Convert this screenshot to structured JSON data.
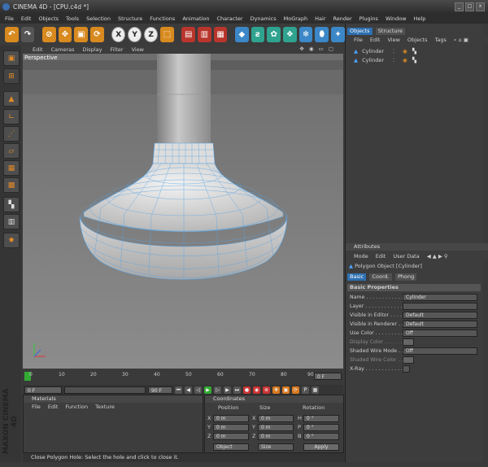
{
  "window": {
    "app": "CINEMA 4D",
    "file": "[CPU.c4d *]",
    "min": "_",
    "max": "□",
    "close": "x"
  },
  "menu": [
    "File",
    "Edit",
    "Objects",
    "Tools",
    "Selection",
    "Structure",
    "Functions",
    "Animation",
    "Character",
    "Dynamics",
    "MoGraph",
    "Hair",
    "Render",
    "Plugins",
    "Window",
    "Help"
  ],
  "toolbar": {
    "x": "X",
    "y": "Y",
    "z": "Z"
  },
  "viewport": {
    "menu": [
      "Edit",
      "Cameras",
      "Display",
      "Filter",
      "View"
    ],
    "label": "Perspective",
    "nav_icons": "✥ ◉ ▭ ▢"
  },
  "timeline": {
    "ticks": [
      "0",
      "10",
      "20",
      "30",
      "40",
      "50",
      "60",
      "70",
      "80",
      "90"
    ],
    "frame_end_label": "0 F"
  },
  "playback": {
    "start": "0 F",
    "end": "90 F"
  },
  "materials": {
    "title": "Materials",
    "menu": [
      "File",
      "Edit",
      "Function",
      "Texture"
    ]
  },
  "coordinates": {
    "title": "Coordinates",
    "cols": [
      "Position",
      "Size",
      "Rotation"
    ],
    "rows": [
      {
        "a": "X",
        "av": "0 m",
        "b": "X",
        "bv": "0 m",
        "c": "H",
        "cv": "0 °"
      },
      {
        "a": "Y",
        "av": "0 m",
        "b": "Y",
        "bv": "0 m",
        "c": "P",
        "cv": "0 °"
      },
      {
        "a": "Z",
        "av": "0 m",
        "b": "Z",
        "bv": "0 m",
        "c": "B",
        "cv": "0 °"
      }
    ],
    "mode": "Object",
    "size_mode": "Size",
    "apply": "Apply"
  },
  "status": "Close Polygon Hole: Select the hole and click to close it.",
  "maxon": "MAXON CINEMA 4D",
  "objects": {
    "tabs": [
      "Objects",
      "Structure"
    ],
    "menu": [
      "File",
      "Edit",
      "View",
      "Objects",
      "Tags"
    ],
    "items": [
      "Cylinder",
      "Cylinder"
    ]
  },
  "attributes": {
    "title": "Attributes",
    "menu": [
      "Mode",
      "Edit",
      "User Data"
    ],
    "object": "Polygon Object [Cylinder]",
    "tabs": [
      "Basic",
      "Coord.",
      "Phong"
    ],
    "section": "Basic Properties",
    "rows": [
      {
        "label": "Name . . . . . . . . . . . .",
        "value": "Cylinder"
      },
      {
        "label": "Layer . . . . . . . . . . . .",
        "value": ""
      },
      {
        "label": "Visible in Editor . . . .",
        "value": "Default"
      },
      {
        "label": "Visible in Renderer . .",
        "value": "Default"
      },
      {
        "label": "Use Color . . . . . . . . .",
        "value": "Off"
      },
      {
        "label": "Display Color . . . . . . .",
        "value": ""
      },
      {
        "label": "Shaded Wire Mode . . .",
        "value": "Off"
      },
      {
        "label": "Shaded Wire Color . . .",
        "value": ""
      },
      {
        "label": "X-Ray . . . . . . . . . . . .",
        "value": ""
      }
    ]
  }
}
